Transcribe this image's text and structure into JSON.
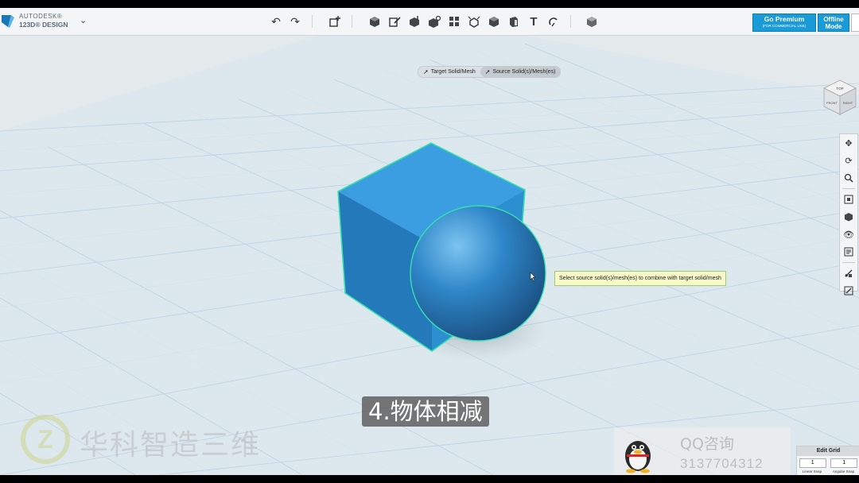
{
  "app": {
    "brand_line1": "AUTODESK®",
    "brand_line2": "123D® DESIGN"
  },
  "toolbar": {
    "icons": [
      "undo-icon",
      "redo-icon",
      "add-icon",
      "primitives-icon",
      "sketch-icon",
      "construct-icon",
      "modify-icon",
      "pattern-icon",
      "grouping-icon",
      "combine-icon",
      "measure-icon",
      "text-icon",
      "snap-icon",
      "material-icon"
    ],
    "premium_label": "Go Premium",
    "premium_sub": "(FOR COMMERCIAL USE)",
    "offline_label_1": "Offline",
    "offline_label_2": "Mode"
  },
  "combine": {
    "target_label": "Target Solid/Mesh",
    "source_label": "Source Solid(s)/Mesh(es)",
    "tooltip": "Select source solid(s)/mesh(es) to combine with target solid/mesh"
  },
  "view_cube": {
    "top": "TOP",
    "front": "FRONT",
    "right": "RIGHT"
  },
  "nav": {
    "items": [
      "pan-icon",
      "orbit-icon",
      "zoom-icon",
      "fit-icon",
      "view-mode-icon",
      "visibility-icon",
      "material-view-icon",
      "snap-tool-icon",
      "edit-tool-icon"
    ]
  },
  "overlay": {
    "subtitle": "4.物体相减",
    "watermark_text": "华科智造三维",
    "qq_title": "QQ咨询",
    "qq_number": "3137704312"
  },
  "edit_grid": {
    "title": "Edit Grid",
    "linear_value": "1",
    "angular_value": "1",
    "linear_label": "Linear Snap",
    "angular_label": "Angular Snap"
  },
  "colors": {
    "accent": "#1a9bd7",
    "cube": "#2b8fd0",
    "highlight": "#37e0b0",
    "grid_bg": "#e6ecf0"
  }
}
